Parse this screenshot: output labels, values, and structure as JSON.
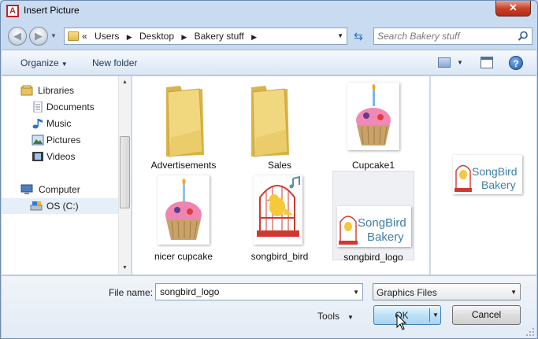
{
  "window": {
    "title": "Insert Picture",
    "app_icon_letter": "A",
    "close_glyph": "✕"
  },
  "nav": {
    "back_glyph": "◀",
    "forward_glyph": "▶",
    "recent_glyph": "▼"
  },
  "address": {
    "overflow": "«",
    "crumbs": [
      "Users",
      "Desktop",
      "Bakery stuff"
    ],
    "separator": "▶",
    "dropdown_glyph": "▼",
    "refresh_glyph": "⇆"
  },
  "search": {
    "placeholder": "Search Bakery stuff"
  },
  "toolbar": {
    "organize": "Organize",
    "caret": "▼",
    "new_folder": "New folder",
    "help_glyph": "?"
  },
  "navpane": {
    "items": [
      {
        "label": "Libraries",
        "icon": "libraries-icon"
      },
      {
        "label": "Documents",
        "icon": "documents-icon"
      },
      {
        "label": "Music",
        "icon": "music-icon"
      },
      {
        "label": "Pictures",
        "icon": "pictures-icon"
      },
      {
        "label": "Videos",
        "icon": "videos-icon"
      },
      {
        "label": "Computer",
        "icon": "computer-icon"
      },
      {
        "label": "OS (C:)",
        "icon": "drive-icon"
      }
    ],
    "scroll_up": "▲",
    "scroll_down": "▼"
  },
  "files": [
    {
      "name": "Advertisements",
      "type": "folder"
    },
    {
      "name": "Sales",
      "type": "folder"
    },
    {
      "name": "Cupcake1",
      "type": "cupcake-image"
    },
    {
      "name": "nicer cupcake",
      "type": "cupcake-image"
    },
    {
      "name": "songbird_bird",
      "type": "bird-image"
    },
    {
      "name": "songbird_logo",
      "type": "logo-image",
      "selected": true
    }
  ],
  "logo_text": {
    "line1": "SongBird",
    "line2": "Bakery"
  },
  "bottom": {
    "filename_label": "File name:",
    "filename_value": "songbird_logo",
    "filter_value": "Graphics Files",
    "tools_label": "Tools",
    "ok_label": "OK",
    "cancel_label": "Cancel"
  },
  "colors": {
    "accent": "#3c7fb1",
    "selection": "#e6eef8",
    "close": "#c7432a"
  }
}
